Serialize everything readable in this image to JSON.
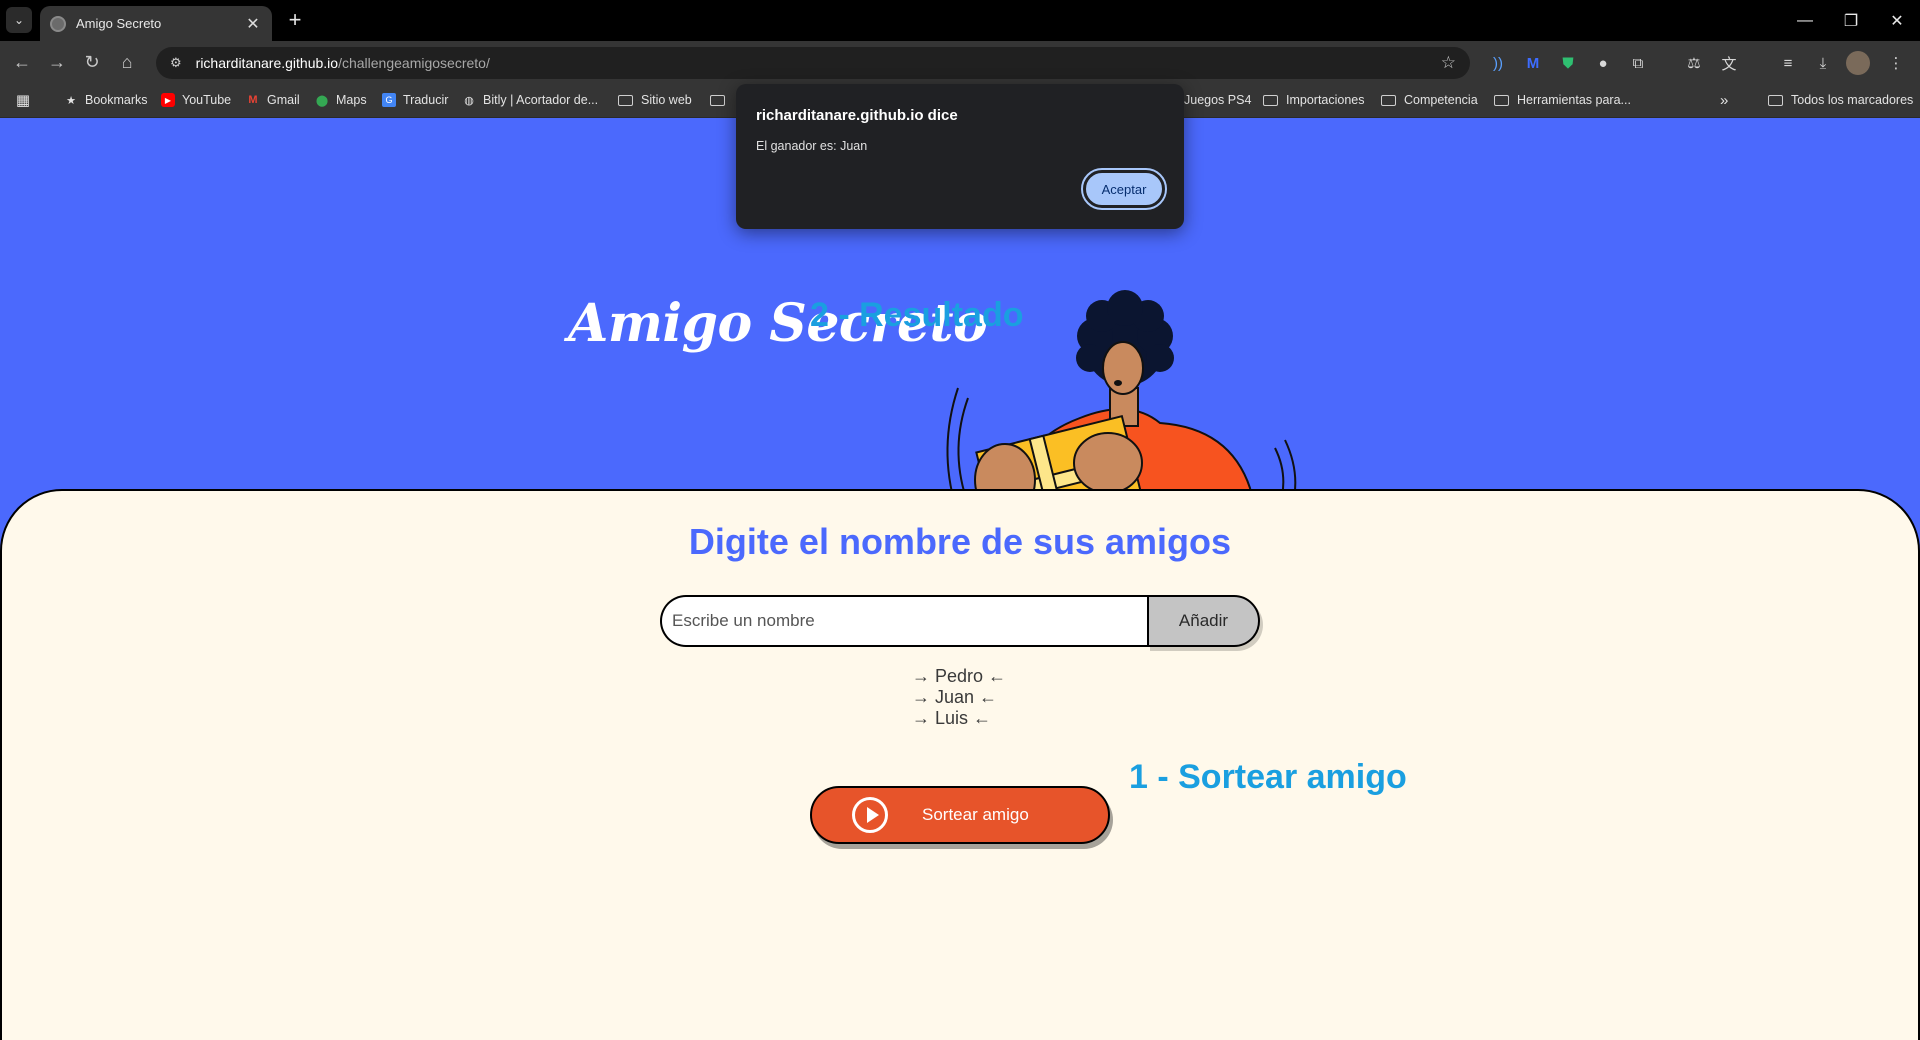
{
  "browser": {
    "tab_title": "Amigo Secreto",
    "url_host": "richarditanare.github.io",
    "url_path": "/challengeamigosecreto/",
    "bookmarks": [
      {
        "label": "Bookmarks",
        "icon": "star-icon"
      },
      {
        "label": "YouTube",
        "icon": "youtube-icon"
      },
      {
        "label": "Gmail",
        "icon": "gmail-icon"
      },
      {
        "label": "Maps",
        "icon": "maps-icon"
      },
      {
        "label": "Traducir",
        "icon": "translate-icon"
      },
      {
        "label": "Bitly | Acortador de...",
        "icon": "globe-icon"
      },
      {
        "label": "Sitio web",
        "icon": "folder-icon"
      },
      {
        "label": "Juegos PS4",
        "icon": "folder-icon"
      },
      {
        "label": "Importaciones",
        "icon": "folder-icon"
      },
      {
        "label": "Competencia",
        "icon": "folder-icon"
      },
      {
        "label": "Herramientas para...",
        "icon": "folder-icon"
      }
    ],
    "all_bookmarks": "Todos los marcadores"
  },
  "page": {
    "title": "Amigo Secreto",
    "section_title": "Digite el nombre de sus amigos",
    "input_placeholder": "Escribe un nombre",
    "add_button": "Añadir",
    "friends": [
      "→ Pedro ←",
      "→ Juan ←",
      "→ Luis ←"
    ],
    "draw_button": "Sortear amigo",
    "colors": {
      "header_bg": "#4b69fd",
      "panel_bg": "#fff9eb",
      "button": "#e7542a",
      "annotation": "#1a9fe0"
    }
  },
  "annotations": {
    "step1": "1 - Sortear amigo",
    "step2": "2 - Resultado"
  },
  "dialog": {
    "title": "richarditanare.github.io dice",
    "message": "El ganador es: Juan",
    "ok_button": "Aceptar"
  }
}
